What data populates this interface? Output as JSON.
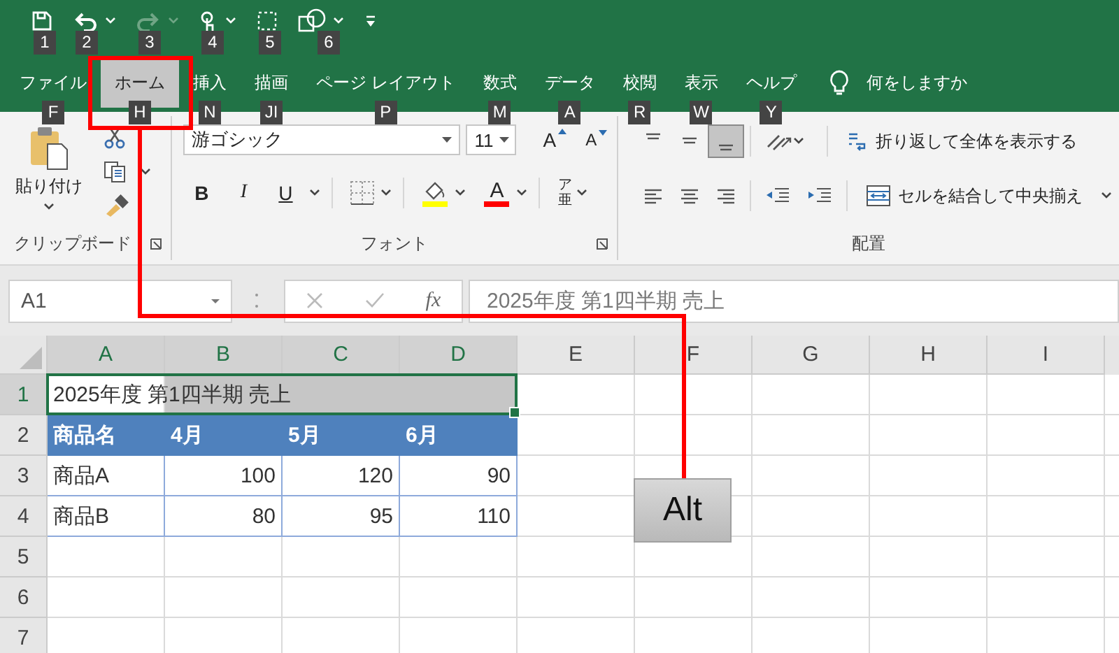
{
  "quick_access": [
    {
      "kind": "save",
      "keytip": "1",
      "disabled": false,
      "menu": false
    },
    {
      "kind": "undo",
      "keytip": "2",
      "disabled": false,
      "menu": true
    },
    {
      "kind": "redo",
      "keytip": "3",
      "disabled": true,
      "menu": true
    },
    {
      "kind": "touch",
      "keytip": "4",
      "disabled": false,
      "menu": true
    },
    {
      "kind": "new",
      "keytip": "5",
      "disabled": false,
      "menu": false
    },
    {
      "kind": "shapes",
      "keytip": "6",
      "disabled": false,
      "menu": true
    },
    {
      "kind": "customize",
      "disabled": false,
      "menu": false
    }
  ],
  "tabs": [
    {
      "label": "ファイル",
      "keytip": "F",
      "selected": false
    },
    {
      "label": "ホーム",
      "keytip": "H",
      "selected": true
    },
    {
      "label": "挿入",
      "keytip": "N",
      "selected": false
    },
    {
      "label": "描画",
      "keytip": "JI",
      "selected": false
    },
    {
      "label": "ページ レイアウト",
      "keytip": "P",
      "selected": false
    },
    {
      "label": "数式",
      "keytip": "M",
      "selected": false
    },
    {
      "label": "データ",
      "keytip": "A",
      "selected": false
    },
    {
      "label": "校閲",
      "keytip": "R",
      "selected": false
    },
    {
      "label": "表示",
      "keytip": "W",
      "selected": false
    },
    {
      "label": "ヘルプ",
      "keytip": "Y",
      "selected": false
    }
  ],
  "tell_me": {
    "label": "何をしますか"
  },
  "ribbon": {
    "clipboard": {
      "paste": "貼り付け",
      "label": "クリップボード"
    },
    "font": {
      "font_name": "游ゴシック",
      "font_size": "11",
      "grow": "A",
      "shrink": "A",
      "styles": [
        {
          "kind": "bold",
          "label": "B"
        },
        {
          "kind": "italic",
          "label": "I"
        },
        {
          "kind": "underline",
          "label": "U"
        }
      ],
      "font_color": "A",
      "phonetic": "ア亜",
      "label": "フォント"
    },
    "alignment": {
      "vertical": [
        {
          "kind": "top",
          "selected": false
        },
        {
          "kind": "middle",
          "selected": false
        },
        {
          "kind": "bottom",
          "selected": true
        }
      ],
      "horizontal": [
        {
          "kind": "left",
          "selected": false
        },
        {
          "kind": "center",
          "selected": false
        },
        {
          "kind": "right",
          "selected": false
        }
      ],
      "wrap_text": "折り返して全体を表示する",
      "merge_center": "セルを結合して中央揃え",
      "label": "配置"
    }
  },
  "formula_bar": {
    "name_box": "A1",
    "function_symbol": "fx",
    "value": "2025年度 第1四半期 売上"
  },
  "sheet": {
    "columns": [
      {
        "label": "A",
        "selected": true
      },
      {
        "label": "B",
        "selected": true
      },
      {
        "label": "C",
        "selected": true
      },
      {
        "label": "D",
        "selected": true
      },
      {
        "label": "E",
        "selected": false
      },
      {
        "label": "F",
        "selected": false
      },
      {
        "label": "G",
        "selected": false
      },
      {
        "label": "H",
        "selected": false
      },
      {
        "label": "I",
        "selected": false
      }
    ],
    "rows": [
      {
        "number": "1",
        "selected": true,
        "kind": "title",
        "cells": [
          {
            "text": "2025年度 第1四半期 売上",
            "kind": "text"
          }
        ]
      },
      {
        "number": "2",
        "selected": false,
        "kind": "header",
        "cells": [
          {
            "text": "商品名",
            "kind": "text"
          },
          {
            "text": "4月",
            "kind": "text"
          },
          {
            "text": "5月",
            "kind": "text"
          },
          {
            "text": "6月",
            "kind": "text"
          }
        ]
      },
      {
        "number": "3",
        "selected": false,
        "kind": "data",
        "cells": [
          {
            "text": "商品A",
            "kind": "text"
          },
          {
            "text": "100",
            "kind": "number"
          },
          {
            "text": "120",
            "kind": "number"
          },
          {
            "text": "90",
            "kind": "number"
          }
        ]
      },
      {
        "number": "4",
        "selected": false,
        "kind": "data",
        "cells": [
          {
            "text": "商品B",
            "kind": "text"
          },
          {
            "text": "80",
            "kind": "number"
          },
          {
            "text": "95",
            "kind": "number"
          },
          {
            "text": "110",
            "kind": "number"
          }
        ]
      },
      {
        "number": "5",
        "selected": false,
        "kind": "blank"
      },
      {
        "number": "6",
        "selected": false,
        "kind": "blank"
      },
      {
        "number": "7",
        "selected": false,
        "kind": "blank"
      }
    ]
  },
  "callout": {
    "key": "Alt"
  }
}
